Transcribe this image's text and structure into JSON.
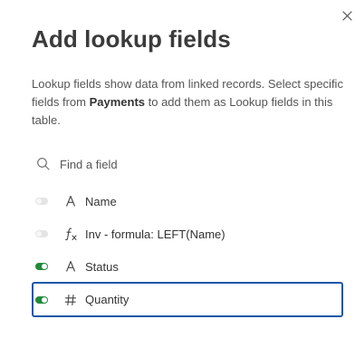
{
  "dialog": {
    "title": "Add lookup fields",
    "description_pre": "Lookup fields show data from linked records. Select specific fields from ",
    "description_table": "Payments",
    "description_post": " to add them as Lookup fields in this table."
  },
  "search": {
    "placeholder": "Find a field",
    "value": ""
  },
  "fields": [
    {
      "label": "Name",
      "type_icon": "text-type-icon",
      "enabled": false
    },
    {
      "label": "Inv - formula: LEFT(Name)",
      "type_icon": "formula-type-icon",
      "enabled": false
    },
    {
      "label": "Status",
      "type_icon": "text-type-icon",
      "enabled": true
    },
    {
      "label": "Quantity",
      "type_icon": "number-type-icon",
      "enabled": true,
      "focused": true
    }
  ],
  "colors": {
    "toggle_on": "#1f8a3a",
    "toggle_off": "#e4e4e4",
    "focus_border": "#1b57a8"
  }
}
